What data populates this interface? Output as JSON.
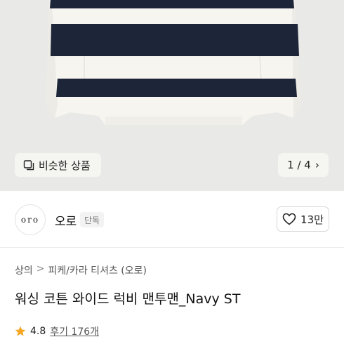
{
  "hero": {
    "similar_label": "비슷한 상품",
    "pager_text": "1 / 4",
    "colors": {
      "navy": "#1d2538",
      "cream": "#f6f5f0",
      "background": "#e9e9e7"
    }
  },
  "brand": {
    "logo_text": "oro",
    "name": "오로",
    "exclusive_badge": "단독",
    "like_count": "13만"
  },
  "breadcrumb": {
    "items": [
      "상의",
      "피케/카라 티셔츠 (오로)"
    ],
    "separator": ">"
  },
  "product": {
    "title": "워싱 코튼 와이드 럭비 맨투맨_Navy ST"
  },
  "rating": {
    "score": "4.8",
    "reviews": "후기 176개",
    "star_color": "#f5a623"
  }
}
